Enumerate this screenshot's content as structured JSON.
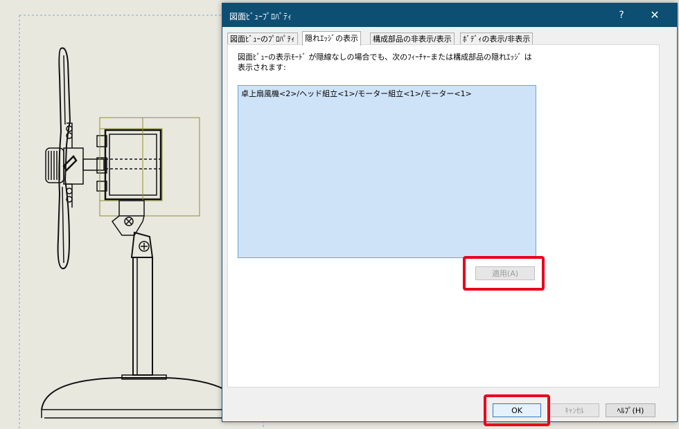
{
  "dialog": {
    "title": "図面ﾋﾞｭｰﾌﾟﾛﾊﾟﾃｨ",
    "help_label": "?",
    "close_label": "✕",
    "tabs": [
      {
        "label": "図面ﾋﾞｭｰのﾌﾟﾛﾊﾟﾃｨ",
        "active": false
      },
      {
        "label": "隠れｴｯｼﾞの表示",
        "active": true
      },
      {
        "label": "構成部品の非表示/表示",
        "active": false
      },
      {
        "label": "ﾎﾞﾃﾞｨの表示/非表示",
        "active": false
      }
    ],
    "description_line1": "図面ﾋﾞｭｰの表示ﾓｰﾄﾞ が隠線なしの場合でも、次のﾌｨｰﾁｬｰまたは構成部品の隠れｴｯｼﾞ は",
    "description_line2": "表示されます:",
    "list_items": [
      "卓上扇風機<2>/ヘッド組立<1>/モーター組立<1>/モーター<1>"
    ],
    "apply_label": "適用(A)",
    "ok_label": "OK",
    "cancel_label": "ｷｬﾝｾﾙ",
    "help_button_label": "ﾍﾙﾌﾟ(H)"
  },
  "colors": {
    "titlebar": "#0d4e73",
    "highlight": "#e8001b",
    "list_selection": "#cfe3f8",
    "canvas_background": "#e9e8df",
    "bounding_box": "#8a8f28"
  }
}
